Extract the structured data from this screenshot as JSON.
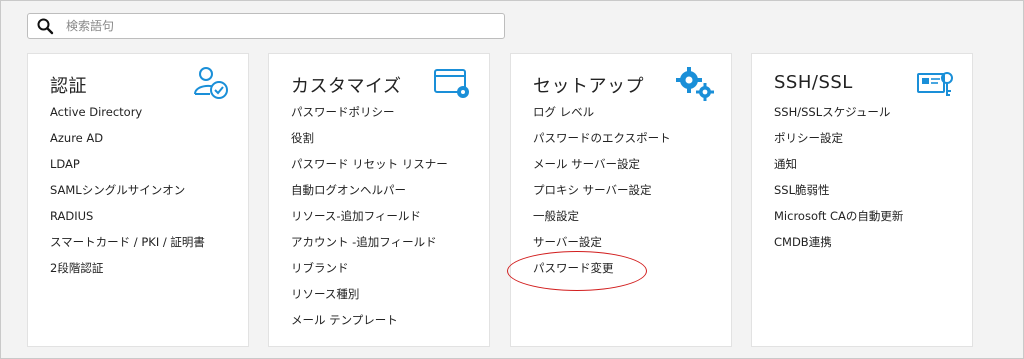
{
  "search": {
    "placeholder": "検索語句",
    "value": ""
  },
  "colors": {
    "accent": "#1a8fd8",
    "highlight": "#d21f1f"
  },
  "cards": [
    {
      "title": "認証",
      "icon": "user-check-icon",
      "items": [
        "Active Directory",
        "Azure AD",
        "LDAP",
        "SAMLシングルサインオン",
        "RADIUS",
        "スマートカード / PKI / 証明書",
        "2段階認証"
      ]
    },
    {
      "title": "カスタマイズ",
      "icon": "window-gear-icon",
      "items": [
        "パスワードポリシー",
        "役割",
        "パスワード リセット リスナー",
        "自動ログオンヘルパー",
        "リソース-追加フィールド",
        "アカウント -追加フィールド",
        "リブランド",
        "リソース種別",
        "メール テンプレート"
      ]
    },
    {
      "title": "セットアップ",
      "icon": "gears-icon",
      "items": [
        "ログ レベル",
        "パスワードのエクスポート",
        "メール サーバー設定",
        "プロキシ サーバー設定",
        "一般設定",
        "サーバー設定",
        "パスワード変更"
      ]
    },
    {
      "title": "SSH/SSL",
      "icon": "certificate-key-icon",
      "items": [
        "SSH/SSLスケジュール",
        "ポリシー設定",
        "通知",
        "SSL脆弱性",
        "Microsoft CAの自動更新",
        "CMDB連携"
      ]
    }
  ]
}
